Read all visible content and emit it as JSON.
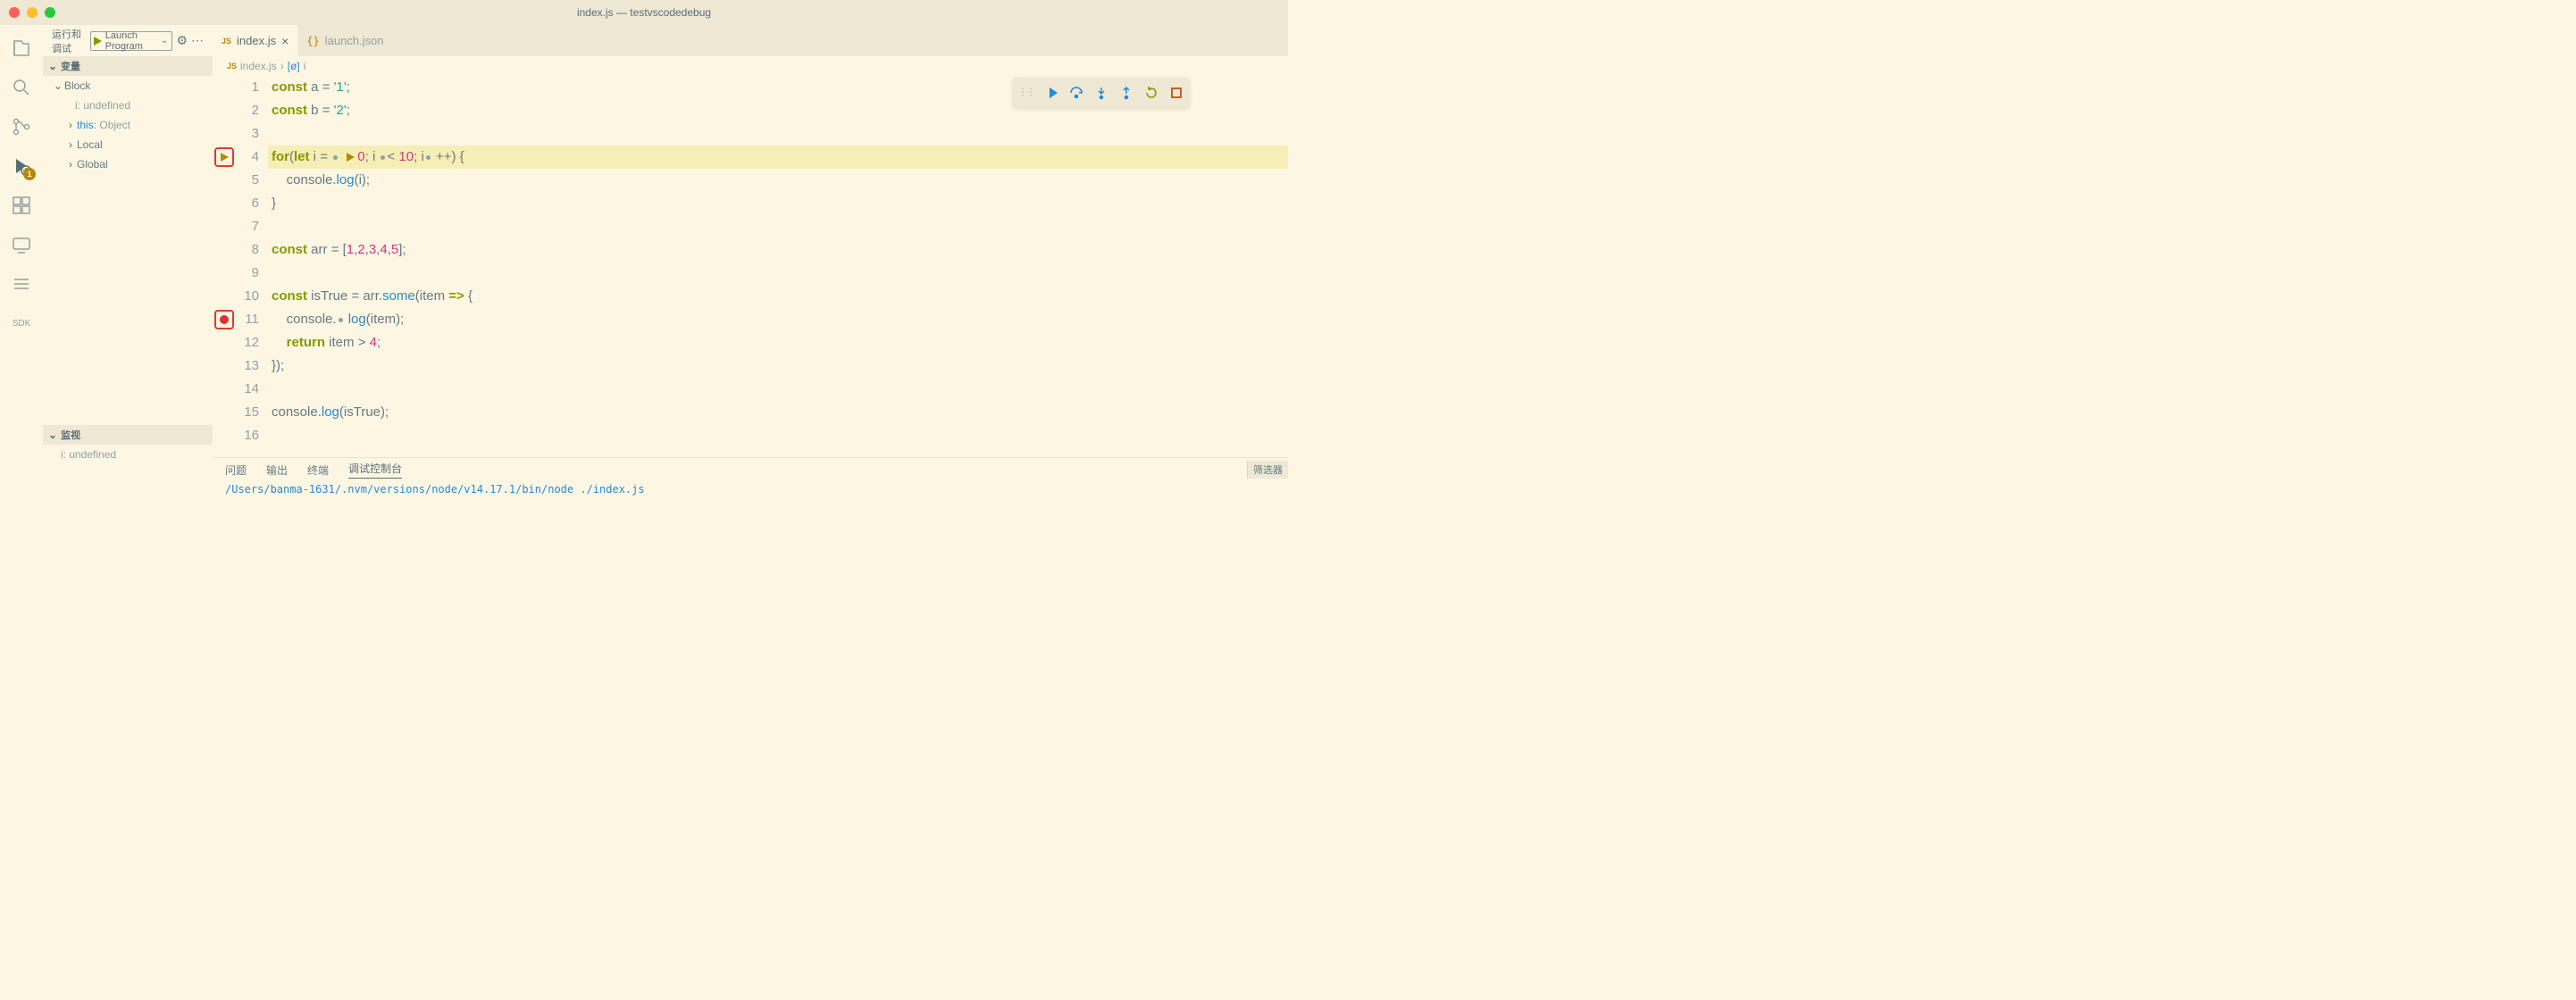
{
  "window": {
    "title": "index.js — testvscodedebug"
  },
  "sidebar": {
    "title": "运行和调试",
    "launch_config": "Launch Program",
    "sections": {
      "variables": {
        "label": "变量",
        "block_label": "Block",
        "block_var": "i: undefined",
        "this_label": "this",
        "this_type": ": Object",
        "local_label": "Local",
        "global_label": "Global"
      },
      "watch": {
        "label": "监视",
        "item": "i: undefined"
      }
    }
  },
  "activitybar": {
    "debug_badge": "1",
    "sdk_label": "SDK"
  },
  "tabs": {
    "active": {
      "name": "index.js",
      "icon": "JS"
    },
    "inactive": {
      "name": "launch.json",
      "icon": "{}"
    }
  },
  "breadcrumb": {
    "file_icon": "JS",
    "file": "index.js",
    "sep": "›",
    "symbol_icon": "[ø]",
    "symbol": "i"
  },
  "editor": {
    "lines": [
      "1",
      "2",
      "3",
      "4",
      "5",
      "6",
      "7",
      "8",
      "9",
      "10",
      "11",
      "12",
      "13",
      "14",
      "15",
      "16"
    ],
    "highlighted_line": 4,
    "logpoint_line": 4,
    "breakpoint_line": 11
  },
  "code": {
    "l1": {
      "kw": "const",
      "v": " a ",
      "op": "=",
      "str": " '1'",
      "end": ";"
    },
    "l2": {
      "kw": "const",
      "v": " b ",
      "op": "=",
      "str": " '2'",
      "end": ";"
    },
    "l4": {
      "kw1": "for",
      "p1": "(",
      "kw2": "let",
      "v1": " i ",
      "op1": "= ",
      "n1": "0",
      "p2": "; i ",
      "op2": "< ",
      "n2": "10",
      "p3": "; i",
      "op3": " ++",
      "p4": ") {"
    },
    "l5": {
      "pad": "    ",
      "obj": "console",
      "dot": ".",
      "fn": "log",
      "p1": "(",
      "arg": "i",
      "p2": ");"
    },
    "l6": {
      "txt": "}"
    },
    "l8": {
      "kw": "const",
      "v": " arr ",
      "op": "= [",
      "n1": "1",
      "c1": ",",
      "n2": "2",
      "c2": ",",
      "n3": "3",
      "c3": ",",
      "n4": "4",
      "c4": ",",
      "n5": "5",
      "end": "];"
    },
    "l10": {
      "kw": "const",
      "v": " isTrue ",
      "op": "= arr.",
      "fn": "some",
      "p1": "(",
      "arg": "item",
      "arrow": " => ",
      "brace": "{"
    },
    "l11": {
      "pad": "    ",
      "obj": "console",
      "dot": ".",
      "fn": "log",
      "p1": "(",
      "arg": "item",
      "p2": ");"
    },
    "l12": {
      "pad": "    ",
      "kw": "return",
      "expr": " item ",
      "op": ">",
      "sp": " ",
      "n": "4",
      "end": ";"
    },
    "l13": {
      "txt": "});"
    },
    "l15": {
      "obj": "console",
      "dot": ".",
      "fn": "log",
      "p1": "(",
      "arg": "isTrue",
      "p2": ");"
    }
  },
  "panel": {
    "tabs": {
      "problems": "问题",
      "output": "输出",
      "terminal": "终端",
      "debug_console": "调试控制台"
    },
    "filter": "筛选器",
    "output_line": "/Users/banma-1631/.nvm/versions/node/v14.17.1/bin/node ./index.js"
  }
}
